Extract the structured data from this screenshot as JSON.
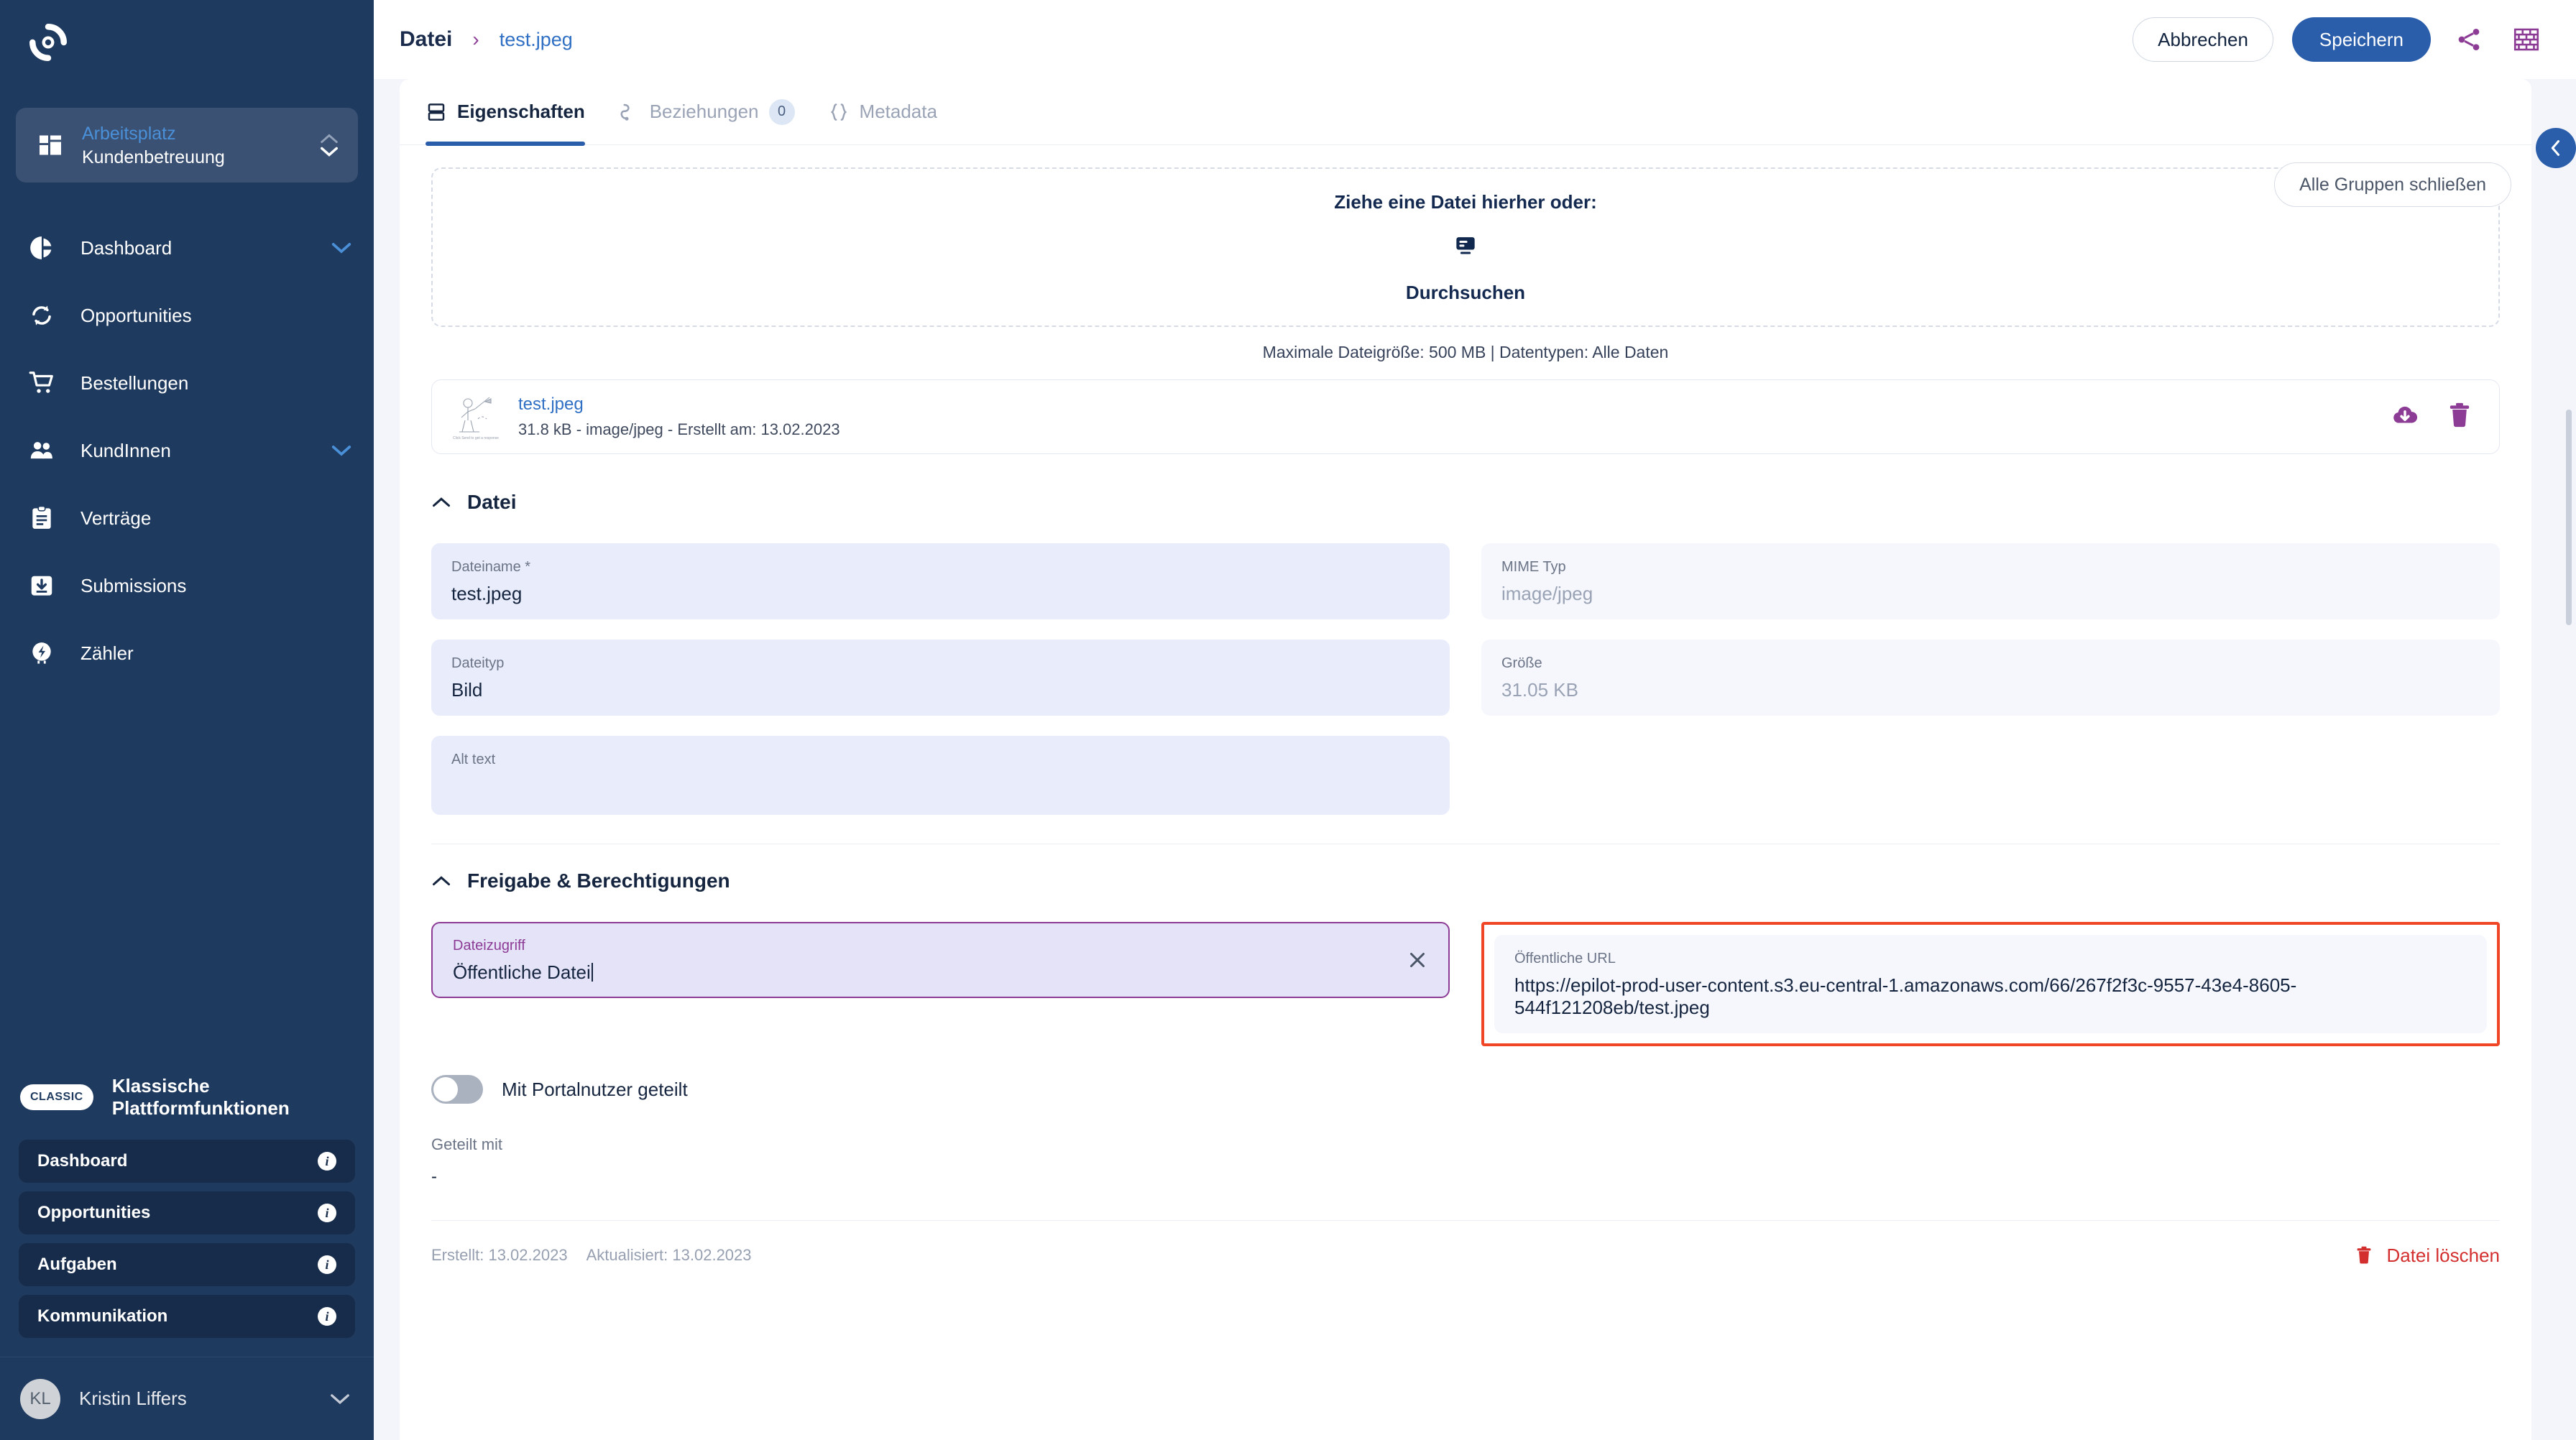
{
  "sidebar": {
    "logo_icon": "epilot-loop-logo",
    "workspace": {
      "icon": "grid-icon",
      "top_label": "Arbeitsplatz",
      "bottom_label": "Kundenbetreuung",
      "chevron_up_icon": "chevron-up-icon",
      "chevron_down_icon": "chevron-down-icon"
    },
    "nav_items": [
      {
        "icon": "pie-chart-icon",
        "label": "Dashboard",
        "has_caret": true
      },
      {
        "icon": "refresh-cycle-icon",
        "label": "Opportunities",
        "has_caret": false
      },
      {
        "icon": "shopping-cart-icon",
        "label": "Bestellungen",
        "has_caret": false
      },
      {
        "icon": "people-icon",
        "label": "KundInnen",
        "has_caret": true
      },
      {
        "icon": "clipboard-icon",
        "label": "Verträge",
        "has_caret": false
      },
      {
        "icon": "inbox-down-icon",
        "label": "Submissions",
        "has_caret": false
      },
      {
        "icon": "meter-icon",
        "label": "Zähler",
        "has_caret": false
      }
    ],
    "classic": {
      "pill": "CLASSIC",
      "title": "Klassische Plattformfunktionen",
      "items": [
        {
          "label": "Dashboard",
          "info_icon": "info-icon"
        },
        {
          "label": "Opportunities",
          "info_icon": "info-icon"
        },
        {
          "label": "Aufgaben",
          "info_icon": "info-icon"
        },
        {
          "label": "Kommunikation",
          "info_icon": "info-icon"
        }
      ]
    },
    "user": {
      "initials": "KL",
      "name": "Kristin Liffers",
      "caret_icon": "chevron-down-icon"
    }
  },
  "topbar": {
    "breadcrumb_root": "Datei",
    "breadcrumb_separator": "›",
    "breadcrumb_current": "test.jpeg",
    "cancel_label": "Abbrechen",
    "save_label": "Speichern",
    "share_icon": "share-icon",
    "layout_icon": "brick-layout-icon"
  },
  "tabs": [
    {
      "icon": "panels-icon",
      "label": "Eigenschaften",
      "active": true,
      "badge": null
    },
    {
      "icon": "relations-icon",
      "label": "Beziehungen",
      "active": false,
      "badge": "0"
    },
    {
      "icon": "braces-icon",
      "label": "Metadata",
      "active": false,
      "badge": null
    }
  ],
  "close_groups_label": "Alle Gruppen schließen",
  "collapse_handle_icon": "chevron-left-icon",
  "dropzone": {
    "title": "Ziehe eine Datei hierher oder:",
    "browse_icon": "browse-file-icon",
    "browse_label": "Durchsuchen",
    "hint": "Maximale Dateigröße: 500 MB  |  Datentypen: Alle Daten"
  },
  "file_row": {
    "thumbnail_icon": "image-thumbnail",
    "name": "test.jpeg",
    "details": "31.8 kB - image/jpeg - Erstellt am: 13.02.2023",
    "download_icon": "cloud-download-icon",
    "delete_icon": "trash-icon"
  },
  "sections": [
    {
      "collapse_icon": "chevron-up-icon",
      "title": "Datei",
      "fields_left": [
        {
          "label": "Dateiname *",
          "value": "test.jpeg",
          "readonly": false
        },
        {
          "label": "Dateityp",
          "value": "Bild",
          "readonly": false
        },
        {
          "label": "Alt text",
          "value": "",
          "readonly": false
        }
      ],
      "fields_right": [
        {
          "label": "MIME Typ",
          "value": "image/jpeg",
          "readonly": true
        },
        {
          "label": "Größe",
          "value": "31.05 KB",
          "readonly": true
        }
      ]
    },
    {
      "collapse_icon": "chevron-up-icon",
      "title": "Freigabe & Berechtigungen",
      "access_field": {
        "label": "Dateizugriff",
        "value": "Öffentliche Datei",
        "clear_icon": "close-icon",
        "focused": true
      },
      "url_field": {
        "label": "Öffentliche URL",
        "value": "https://epilot-prod-user-content.s3.eu-central-1.amazonaws.com/66/267f2f3c-9557-43e4-8605-544f121208eb/test.jpeg",
        "readonly": true,
        "highlight_color": "#f04625"
      },
      "toggle": {
        "label": "Mit Portalnutzer geteilt",
        "on": false
      },
      "shared_with": {
        "label": "Geteilt mit",
        "value": "-"
      }
    }
  ],
  "footer": {
    "created": "Erstellt: 13.02.2023",
    "updated": "Aktualisiert: 13.02.2023",
    "delete_icon": "trash-icon",
    "delete_label": "Datei löschen"
  },
  "colors": {
    "sidebar_bg": "#1f3a5f",
    "primary": "#2a5eab",
    "accent_purple": "#8d3c96",
    "danger": "#d32f2f",
    "highlight": "#f04625",
    "field_bg": "#e9ecfa"
  }
}
